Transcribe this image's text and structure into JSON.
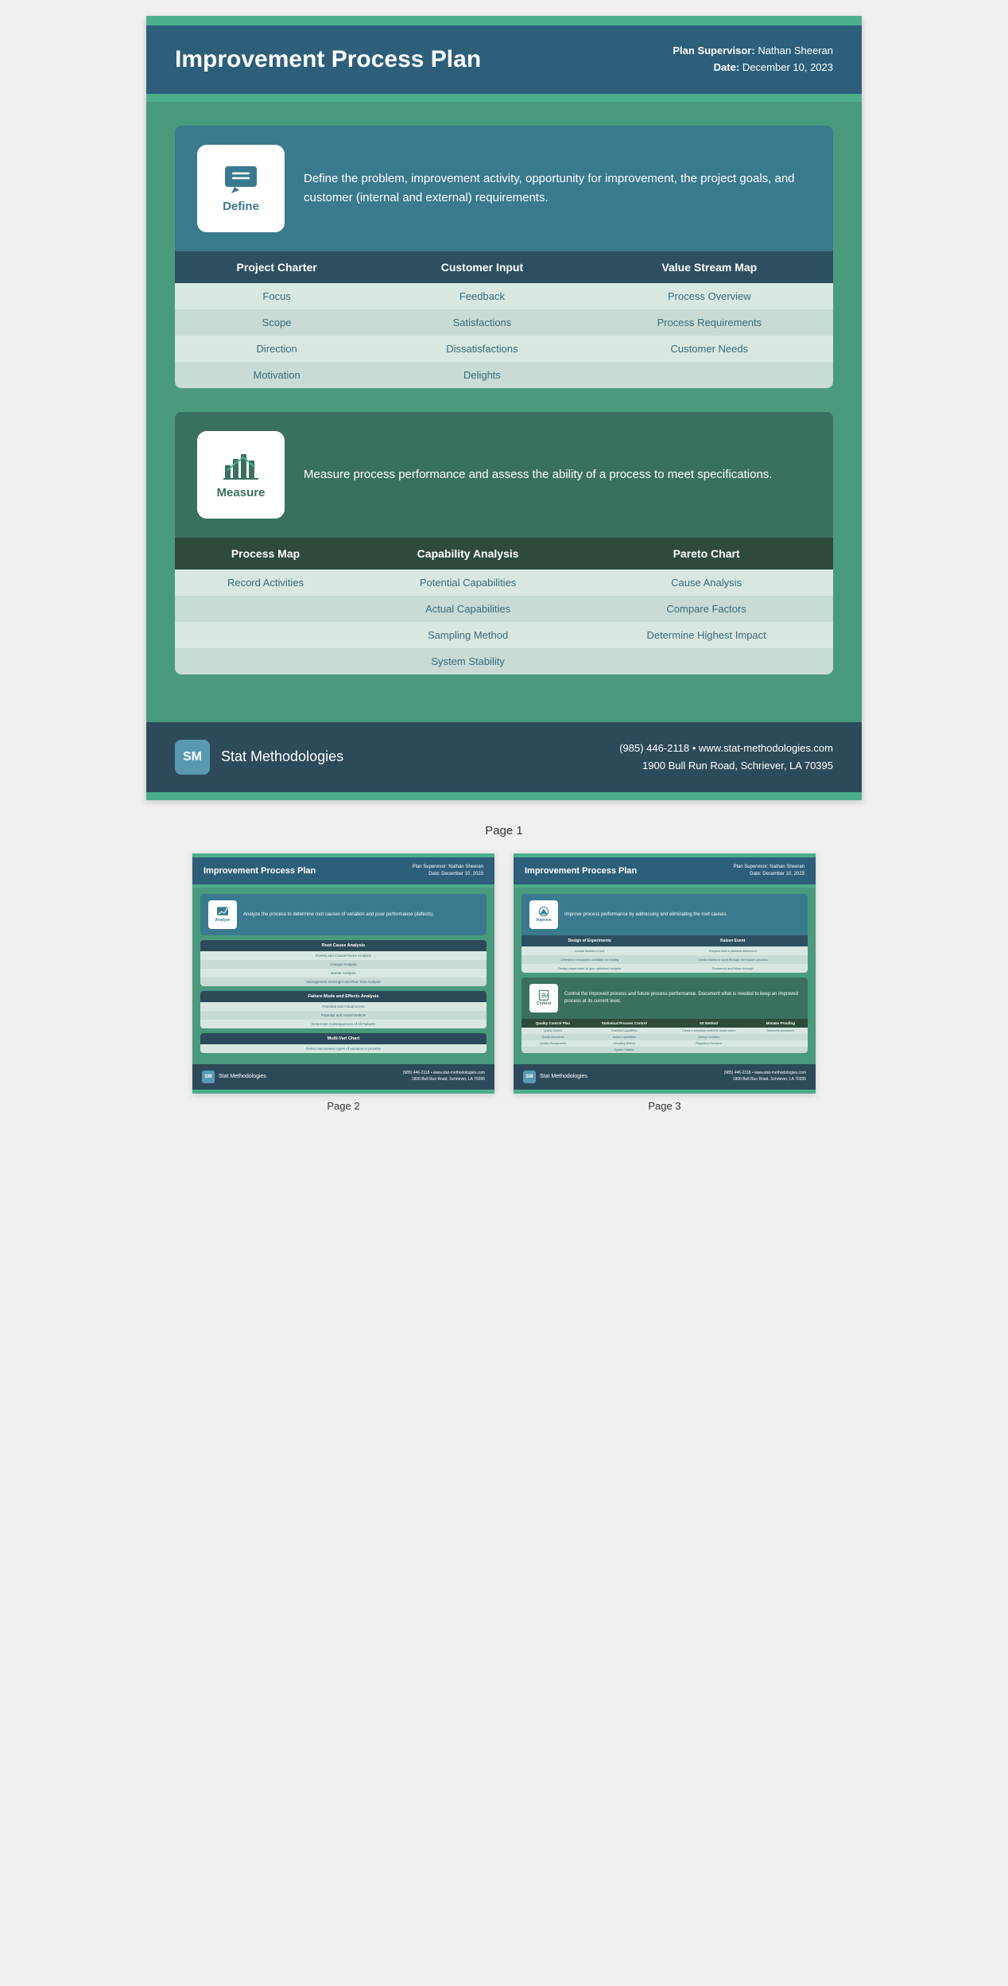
{
  "page1": {
    "topBar": true,
    "header": {
      "title": "Improvement Process Plan",
      "supervisor_label": "Plan Supervisor:",
      "supervisor_value": "Nathan Sheeran",
      "date_label": "Date:",
      "date_value": "December 10, 2023"
    },
    "define": {
      "icon_label": "Define",
      "description": "Define the problem, improvement activity, opportunity for improvement, the project goals, and customer (internal and external) requirements.",
      "columns": [
        "Project Charter",
        "Customer Input",
        "Value Stream Map"
      ],
      "rows": [
        [
          "Focus",
          "Feedback",
          "Process Overview"
        ],
        [
          "Scope",
          "Satisfactions",
          "Process Requirements"
        ],
        [
          "Direction",
          "Dissatisfactions",
          "Customer Needs"
        ],
        [
          "Motivation",
          "Delights",
          ""
        ]
      ]
    },
    "measure": {
      "icon_label": "Measure",
      "description": "Measure process performance and assess the ability of a process to meet specifications.",
      "columns": [
        "Process Map",
        "Capability Analysis",
        "Pareto Chart"
      ],
      "rows": [
        [
          "Record Activities",
          "Potential Capabilities",
          "Cause Analysis"
        ],
        [
          "",
          "Actual Capabilities",
          "Compare Factors"
        ],
        [
          "",
          "Sampling Method",
          "Determine Highest Impact"
        ],
        [
          "",
          "System Stability",
          ""
        ]
      ]
    },
    "footer": {
      "logo_text": "SM",
      "company": "Stat Methodologies",
      "phone": "(985) 446-2118",
      "website": "www.stat-methodologies.com",
      "address": "1900 Bull Run Road, Schriever, LA 70395"
    }
  },
  "page_label": "Page 1",
  "page2": {
    "header": {
      "title": "Improvement Process Plan",
      "supervisor_label": "Plan Supervisor:",
      "supervisor_value": "Nathan Sheeran",
      "date_label": "Date:",
      "date_value": "December 10, 2023"
    },
    "analyze": {
      "icon_label": "Analyze",
      "description": "Analyze the process to determine root causes of variation and poor performance (defects)."
    },
    "root_cause": {
      "title": "Root Cause Analysis",
      "rows": [
        "Events and Causal Factor Analysis",
        "Change Analysis",
        "Barrier Analysis",
        "Management Oversight and Risk Tree Analysis"
      ]
    },
    "fmea": {
      "title": "Failure Mode and Effects Analysis",
      "rows": [
        "Potential and Actual Errors",
        "Potential and Actual Defects",
        "Determine Consequences of All Failures"
      ]
    },
    "multi_vari": {
      "title": "Multi-Vari Chart",
      "rows": [
        "Detect and assess types of variation in process"
      ]
    },
    "footer": {
      "logo_text": "SM",
      "company": "Stat Methodologies",
      "phone": "(985) 446-2118",
      "website": "www.stat-methodologies.com",
      "address": "1900 Bull Run Road, Schriever, LA 70395"
    }
  },
  "page2_label": "Page 2",
  "page3": {
    "header": {
      "title": "Improvement Process Plan",
      "supervisor_label": "Plan Supervisor:",
      "supervisor_value": "Nathan Sheeran",
      "date_label": "Date:",
      "date_value": "December 10, 2023"
    },
    "improve": {
      "icon_label": "Improve",
      "description": "Improve process performance by addressing and eliminating the root causes.",
      "col1": "Design of Experiments",
      "col2": "Kaizen Event",
      "rows": [
        [
          "Isolate factors to test",
          "Prepare with a problem statement"
        ],
        [
          "Determine resources available for testing",
          "Create teams to work through the Kaizen process"
        ],
        [
          "Design experiment to give optimized insights",
          "Document and follow through"
        ]
      ]
    },
    "control": {
      "icon_label": "Control",
      "description": "Control the improved process and future process performance. Document what is needed to keep an improved process at its current level.",
      "col1": "Quality Control Plan",
      "col2": "Statistical Process Control",
      "col3": "5S Method",
      "col4": "Mistake Proofing",
      "rows": [
        [
          "Quality Control",
          "Potential Capabilities",
          "Create a workplace suited for visual control",
          "Determine procedures"
        ],
        [
          "Quality Assurance",
          "Actual Capabilities",
          "Setting Functions",
          ""
        ],
        [
          "Quality Management",
          "Sampling Method",
          "Regulatory Functions",
          ""
        ],
        [
          "",
          "System Stability",
          "",
          ""
        ]
      ]
    },
    "footer": {
      "logo_text": "SM",
      "company": "Stat Methodologies",
      "phone": "(985) 446-2118",
      "website": "www.stat-methodologies.com",
      "address": "1900 Bull Run Road, Schriever, LA 70395"
    }
  },
  "page3_label": "Page 3"
}
